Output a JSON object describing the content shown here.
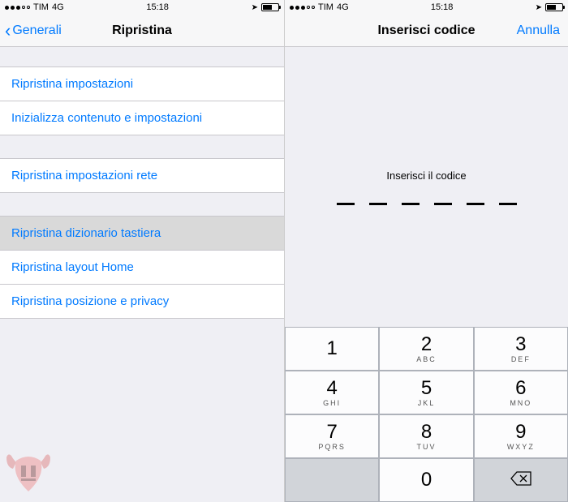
{
  "status": {
    "carrier": "TIM",
    "network": "4G",
    "time": "15:18"
  },
  "left": {
    "back": "Generali",
    "title": "Ripristina",
    "rows": [
      "Ripristina impostazioni",
      "Inizializza contenuto e impostazioni",
      "Ripristina impostazioni rete",
      "Ripristina dizionario tastiera",
      "Ripristina layout Home",
      "Ripristina posizione e privacy"
    ]
  },
  "right": {
    "title": "Inserisci codice",
    "cancel": "Annulla",
    "prompt": "Inserisci il codice"
  },
  "keypad": {
    "k1": {
      "n": "1",
      "s": ""
    },
    "k2": {
      "n": "2",
      "s": "ABC"
    },
    "k3": {
      "n": "3",
      "s": "DEF"
    },
    "k4": {
      "n": "4",
      "s": "GHI"
    },
    "k5": {
      "n": "5",
      "s": "JKL"
    },
    "k6": {
      "n": "6",
      "s": "MNO"
    },
    "k7": {
      "n": "7",
      "s": "PQRS"
    },
    "k8": {
      "n": "8",
      "s": "TUV"
    },
    "k9": {
      "n": "9",
      "s": "WXYZ"
    },
    "k0": {
      "n": "0",
      "s": ""
    }
  }
}
